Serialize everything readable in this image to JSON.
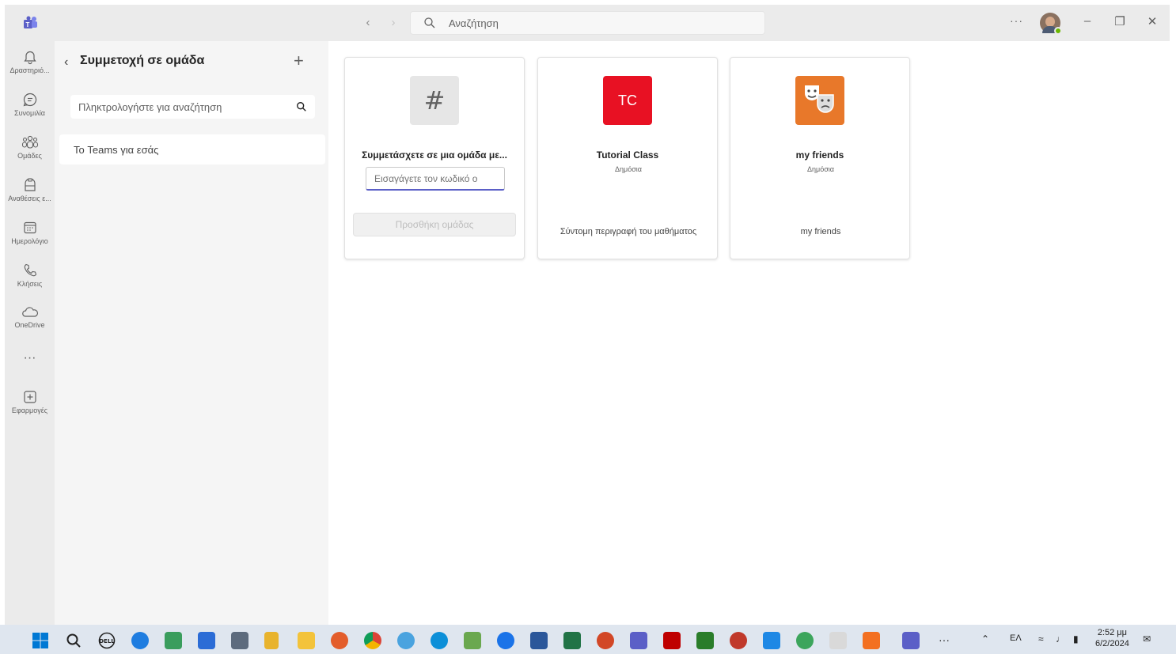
{
  "titlebar": {
    "search_placeholder": "Αναζήτηση",
    "more": "···"
  },
  "rail": {
    "items": [
      {
        "label": "Δραστηριό...",
        "icon": "bell-icon"
      },
      {
        "label": "Συνομιλία",
        "icon": "chat-icon"
      },
      {
        "label": "Ομάδες",
        "icon": "teams-icon"
      },
      {
        "label": "Αναθέσεις ε...",
        "icon": "assignments-icon"
      },
      {
        "label": "Ημερολόγιο",
        "icon": "calendar-icon"
      },
      {
        "label": "Κλήσεις",
        "icon": "phone-icon"
      },
      {
        "label": "OneDrive",
        "icon": "cloud-icon"
      },
      {
        "label": "Εφαρμογές",
        "icon": "apps-add-icon"
      }
    ],
    "more": "···"
  },
  "panel": {
    "title": "Συμμετοχή σε ομάδα",
    "search_placeholder": "Πληκτρολογήστε για αναζήτηση",
    "item": "Το Teams για εσάς"
  },
  "cards": {
    "join": {
      "title": "Συμμετάσχετε σε μια ομάδα με...",
      "input_placeholder": "Εισαγάγετε τον κωδικό ο",
      "button": "Προσθήκη ομάδας",
      "icon": "#"
    },
    "tutorial": {
      "initials": "TC",
      "name": "Tutorial Class",
      "privacy": "Δημόσια",
      "description": "Σύντομη περιγραφή του μαθήματος",
      "color": "#e81123"
    },
    "friends": {
      "name": "my friends",
      "privacy": "Δημόσια",
      "description": "my friends",
      "color": "#e8782a"
    }
  },
  "taskbar": {
    "lang": "ΕΛ",
    "time": "2:52 μμ",
    "date": "6/2/2024"
  }
}
